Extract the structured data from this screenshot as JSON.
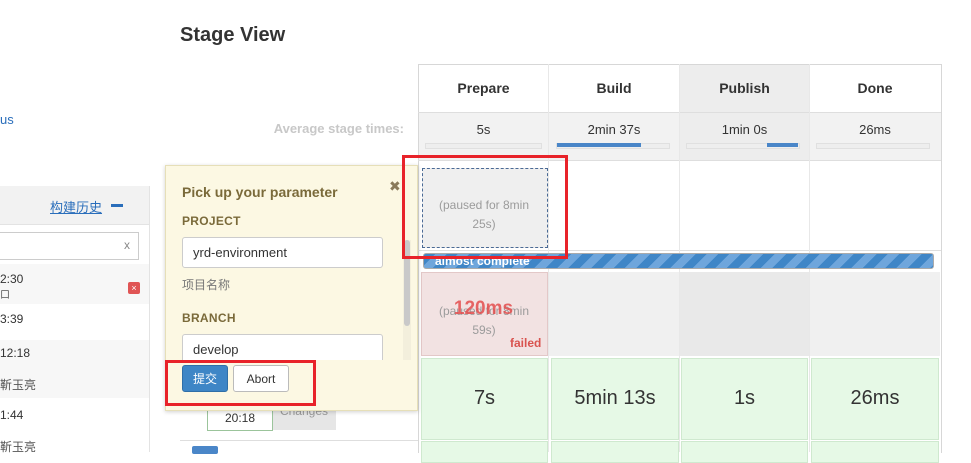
{
  "sidebar": {
    "link_fragment": "us",
    "history_title": "构建历史",
    "filter_clear": "x",
    "rows": [
      {
        "time": "2:30",
        "sub": "口"
      },
      {
        "time": "3:39",
        "sub": ""
      },
      {
        "time": "12:18",
        "sub": "靳玉亮"
      },
      {
        "time": "1:44",
        "sub": "靳玉亮"
      }
    ]
  },
  "stage_view": {
    "title": "Stage View",
    "avg_label": "Average stage times:",
    "stages": [
      {
        "name": "Prepare",
        "avg": "5s",
        "avg_fraction": 0.0
      },
      {
        "name": "Build",
        "avg": "2min 37s",
        "avg_fraction": 0.75
      },
      {
        "name": "Publish",
        "avg": "1min 0s",
        "avg_fraction": 0.28
      },
      {
        "name": "Done",
        "avg": "26ms",
        "avg_fraction": 0.0
      }
    ],
    "current_run": {
      "paused_text": "(paused for 8min 25s)",
      "progress_label": "almost complete"
    },
    "failed_run": {
      "paused_bg_text": "(paused for 8min 59s)",
      "duration": "120ms",
      "status": "failed"
    },
    "success_run": {
      "durations": [
        "7s",
        "5min 13s",
        "1s",
        "26ms"
      ],
      "build_time": "20:18",
      "changes_label": "Changes"
    }
  },
  "popup": {
    "title": "Pick up your parameter",
    "close_glyph": "✖",
    "params": [
      {
        "label": "PROJECT",
        "value": "yrd-environment",
        "description": "项目名称"
      },
      {
        "label": "BRANCH",
        "value": "develop"
      }
    ],
    "submit_label": "提交",
    "abort_label": "Abort"
  },
  "colors": {
    "highlight": "#e8232a",
    "progress": "#3f86c7",
    "success_cell": "#e6f9e6",
    "failed_cell": "#f2e2e2"
  }
}
